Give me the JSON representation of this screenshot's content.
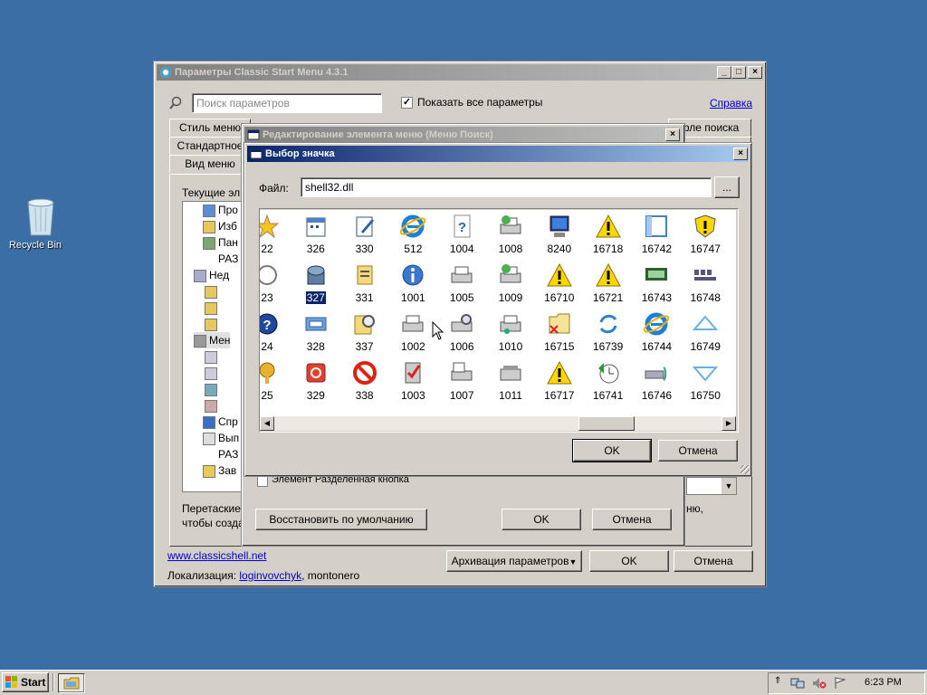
{
  "desktop": {
    "recycle_label": "Recycle Bin"
  },
  "main_window": {
    "title": "Параметры Classic Start Menu 4.3.1",
    "search_placeholder": "Поиск параметров",
    "show_all_label": "Показать все параметры",
    "help_link": "Справка",
    "tabs": [
      "Стиль меню",
      "Стандартное",
      "Вид меню"
    ],
    "right_tab": "фле поиска",
    "right_tab2": "ь",
    "current_items_label": "Текущие эл",
    "tree_items": [
      "Про",
      "Изб",
      "Пан",
      "РАЗ",
      "Нед",
      "",
      "",
      "",
      "Мен",
      "",
      "",
      "",
      "",
      "Спр",
      "Вып",
      "РАЗ",
      "Зав"
    ],
    "hint_line1": "Перетаские",
    "hint_line2": "чтобы созда",
    "hint_right": "ню,",
    "site_link": "www.classicshell.net",
    "localization_label": "Локализация:",
    "localization_link": "loginvovchyk",
    "localization_rest": ", montonero",
    "backup_button": "Архивация параметров",
    "ok_button": "OK",
    "cancel_button": "Отмена"
  },
  "edit_dialog": {
    "title": "Редактирование элемента меню (Меню Поиск)",
    "element_label": "Элемент  Разделенная кнопка",
    "restore_button": "Восстановить по умолчанию",
    "ok_button": "OK",
    "cancel_button": "Отмена"
  },
  "icon_dialog": {
    "title": "Выбор значка",
    "file_label": "Файл:",
    "file_value": "shell32.dll",
    "browse_button": "...",
    "ok_button": "OK",
    "cancel_button": "Отмена",
    "selected": "327",
    "icons": [
      [
        "22",
        "326",
        "330",
        "512",
        "1004",
        "1008",
        "8240",
        "16718",
        "16742",
        "16747"
      ],
      [
        "23",
        "327",
        "331",
        "1001",
        "1005",
        "1009",
        "16710",
        "16721",
        "16743",
        "16748"
      ],
      [
        "24",
        "328",
        "337",
        "1002",
        "1006",
        "1010",
        "16715",
        "16739",
        "16744",
        "16749"
      ],
      [
        "25",
        "329",
        "338",
        "1003",
        "1007",
        "1011",
        "16717",
        "16741",
        "16746",
        "16750"
      ]
    ],
    "icon_kinds": [
      [
        "star-icon",
        "calendar-icon",
        "pen-doc-icon",
        "ie-icon",
        "help-doc-icon",
        "printer-net-icon",
        "computer-icon",
        "warning-icon",
        "window-icon",
        "shield-icon"
      ],
      [
        "circle-icon",
        "server-icon",
        "stack-icon",
        "info-icon",
        "printer-icon",
        "printer-net-icon",
        "warning-icon",
        "warning-icon",
        "network-icon",
        "grid-icon"
      ],
      [
        "help-icon",
        "card-icon",
        "search-doc-icon",
        "printer-icon",
        "printer-search-icon",
        "printer-network-icon",
        "folder-delete-icon",
        "refresh-icon",
        "ie-icon",
        "triangle-up-icon"
      ],
      [
        "key-icon",
        "power-icon",
        "forbidden-icon",
        "checklist-icon",
        "fax-printer-icon",
        "fax-icon",
        "warning-icon",
        "clock-icon",
        "usb-icon",
        "triangle-down-icon"
      ]
    ]
  },
  "taskbar": {
    "start_label": "Start",
    "clock": "6:23 PM"
  }
}
